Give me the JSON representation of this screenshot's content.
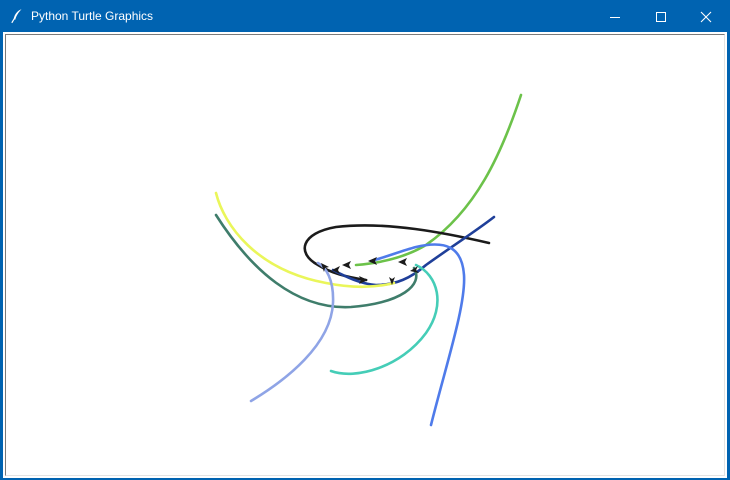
{
  "window": {
    "title": "Python Turtle Graphics",
    "icon": "feather-icon",
    "controls": {
      "minimize": "minimize-icon",
      "maximize": "maximize-icon",
      "close": "close-icon"
    }
  },
  "colors": {
    "titlebar": "#0063b1",
    "canvas_background": "#ffffff",
    "trails": {
      "light-green": "#6cc24a",
      "black": "#1b1b1b",
      "navy": "#1f3f99",
      "royal-blue": "#4f7bea",
      "yellow": "#eaf65a",
      "teal": "#3f7d6b",
      "periwinkle": "#8fa4e6",
      "turquoise": "#45cdb7"
    }
  }
}
